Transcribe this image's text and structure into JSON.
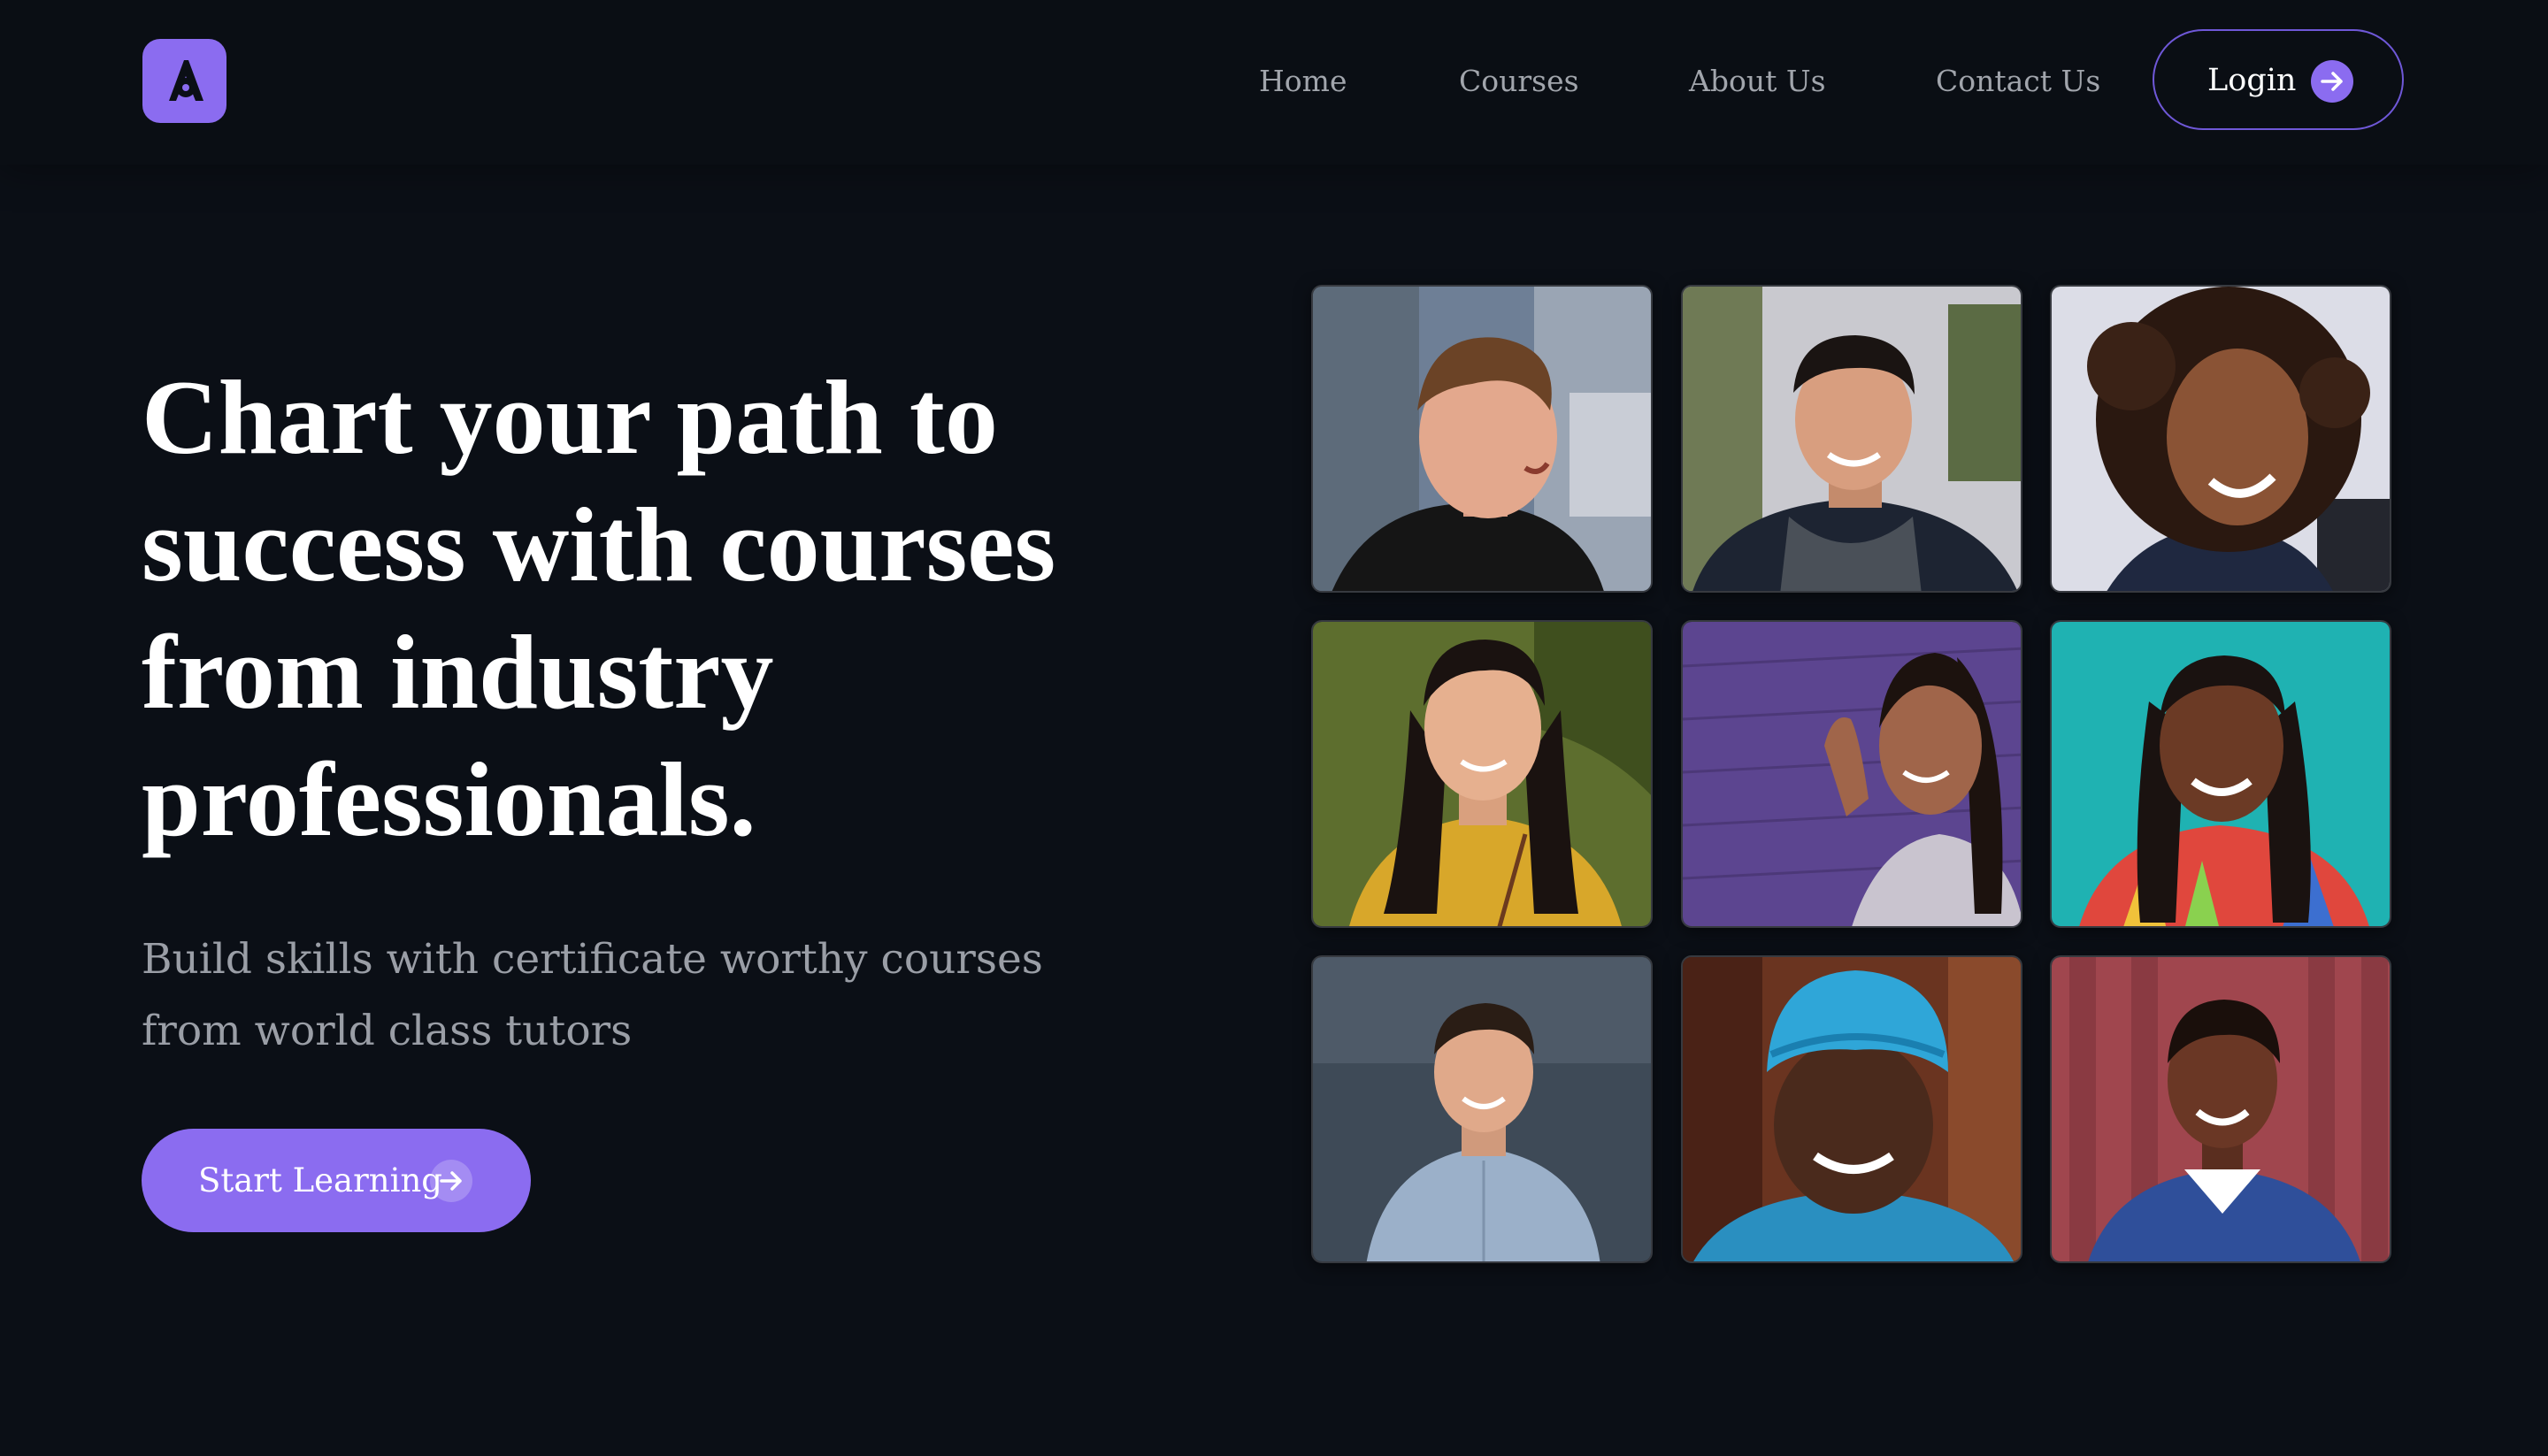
{
  "brand": {
    "logo_icon": "a-logo-icon",
    "accent_color": "#8b6cf0"
  },
  "nav": {
    "links": [
      {
        "label": "Home"
      },
      {
        "label": "Courses"
      },
      {
        "label": "About Us"
      },
      {
        "label": "Contact Us"
      }
    ],
    "login": {
      "label": "Login",
      "icon": "arrow-right-icon"
    }
  },
  "hero": {
    "headline": "Chart your path to success with courses from industry professionals.",
    "subtitle": "Build skills with certificate worthy courses from world class tutors",
    "cta": {
      "label": "Start Learning",
      "icon": "arrow-right-icon"
    }
  },
  "photo_grid": {
    "tiles": [
      {
        "subject": "smiling man outdoors"
      },
      {
        "subject": "man with scarf smiling"
      },
      {
        "subject": "woman with curly hair laughing"
      },
      {
        "subject": "woman in yellow top"
      },
      {
        "subject": "woman against purple wall"
      },
      {
        "subject": "woman with braids on teal background"
      },
      {
        "subject": "man in blue shirt"
      },
      {
        "subject": "man with blue turban"
      },
      {
        "subject": "woman laughing against red wall"
      }
    ]
  }
}
